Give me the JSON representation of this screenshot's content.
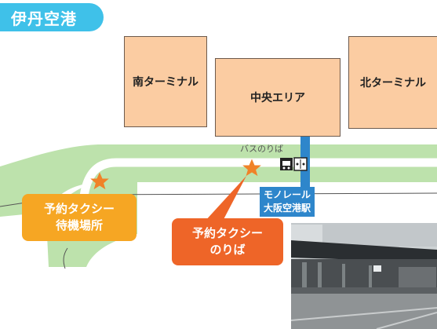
{
  "map": {
    "title": "伊丹空港",
    "buildings": {
      "south_terminal": "南ターミナル",
      "central_area": "中央エリア",
      "north_terminal": "北ターミナル"
    },
    "bus_stop_label": "バスのりば",
    "monorail_station": [
      "モノレール",
      "大阪空港駅"
    ],
    "taxi_waiting": [
      "予約タクシー",
      "待機場所"
    ],
    "taxi_pickup": [
      "予約タクシー",
      "のりば"
    ]
  },
  "colors": {
    "title_badge": "#3fc1e9",
    "building_fill": "#fbcca2",
    "road": "#bde2ac",
    "monorail": "#2e86cb",
    "star": "#f08228",
    "taxi_waiting_callout": "#f6a623",
    "taxi_pickup_callout": "#ee6528"
  },
  "icons": [
    "bus-icon",
    "elevator-icon",
    "star-icon"
  ]
}
